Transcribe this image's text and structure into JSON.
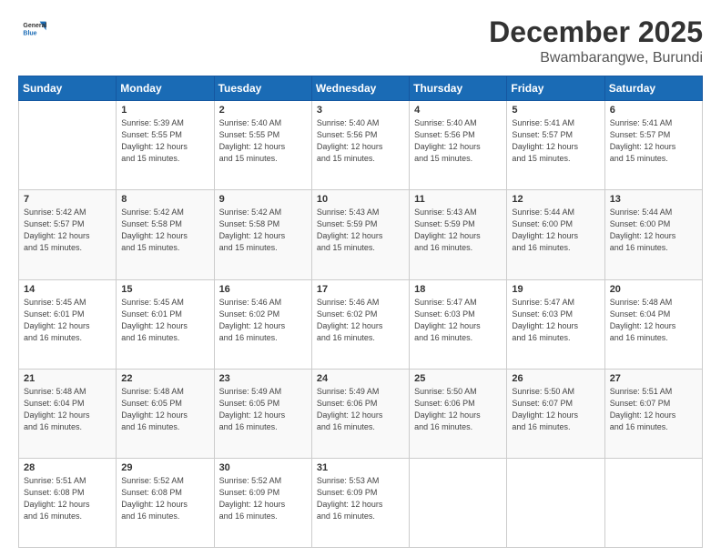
{
  "header": {
    "logo_general": "General",
    "logo_blue": "Blue",
    "month": "December 2025",
    "location": "Bwambarangwe, Burundi"
  },
  "days_of_week": [
    "Sunday",
    "Monday",
    "Tuesday",
    "Wednesday",
    "Thursday",
    "Friday",
    "Saturday"
  ],
  "weeks": [
    [
      {
        "day": "",
        "info": ""
      },
      {
        "day": "1",
        "info": "Sunrise: 5:39 AM\nSunset: 5:55 PM\nDaylight: 12 hours\nand 15 minutes."
      },
      {
        "day": "2",
        "info": "Sunrise: 5:40 AM\nSunset: 5:55 PM\nDaylight: 12 hours\nand 15 minutes."
      },
      {
        "day": "3",
        "info": "Sunrise: 5:40 AM\nSunset: 5:56 PM\nDaylight: 12 hours\nand 15 minutes."
      },
      {
        "day": "4",
        "info": "Sunrise: 5:40 AM\nSunset: 5:56 PM\nDaylight: 12 hours\nand 15 minutes."
      },
      {
        "day": "5",
        "info": "Sunrise: 5:41 AM\nSunset: 5:57 PM\nDaylight: 12 hours\nand 15 minutes."
      },
      {
        "day": "6",
        "info": "Sunrise: 5:41 AM\nSunset: 5:57 PM\nDaylight: 12 hours\nand 15 minutes."
      }
    ],
    [
      {
        "day": "7",
        "info": "Sunrise: 5:42 AM\nSunset: 5:57 PM\nDaylight: 12 hours\nand 15 minutes."
      },
      {
        "day": "8",
        "info": "Sunrise: 5:42 AM\nSunset: 5:58 PM\nDaylight: 12 hours\nand 15 minutes."
      },
      {
        "day": "9",
        "info": "Sunrise: 5:42 AM\nSunset: 5:58 PM\nDaylight: 12 hours\nand 15 minutes."
      },
      {
        "day": "10",
        "info": "Sunrise: 5:43 AM\nSunset: 5:59 PM\nDaylight: 12 hours\nand 15 minutes."
      },
      {
        "day": "11",
        "info": "Sunrise: 5:43 AM\nSunset: 5:59 PM\nDaylight: 12 hours\nand 16 minutes."
      },
      {
        "day": "12",
        "info": "Sunrise: 5:44 AM\nSunset: 6:00 PM\nDaylight: 12 hours\nand 16 minutes."
      },
      {
        "day": "13",
        "info": "Sunrise: 5:44 AM\nSunset: 6:00 PM\nDaylight: 12 hours\nand 16 minutes."
      }
    ],
    [
      {
        "day": "14",
        "info": "Sunrise: 5:45 AM\nSunset: 6:01 PM\nDaylight: 12 hours\nand 16 minutes."
      },
      {
        "day": "15",
        "info": "Sunrise: 5:45 AM\nSunset: 6:01 PM\nDaylight: 12 hours\nand 16 minutes."
      },
      {
        "day": "16",
        "info": "Sunrise: 5:46 AM\nSunset: 6:02 PM\nDaylight: 12 hours\nand 16 minutes."
      },
      {
        "day": "17",
        "info": "Sunrise: 5:46 AM\nSunset: 6:02 PM\nDaylight: 12 hours\nand 16 minutes."
      },
      {
        "day": "18",
        "info": "Sunrise: 5:47 AM\nSunset: 6:03 PM\nDaylight: 12 hours\nand 16 minutes."
      },
      {
        "day": "19",
        "info": "Sunrise: 5:47 AM\nSunset: 6:03 PM\nDaylight: 12 hours\nand 16 minutes."
      },
      {
        "day": "20",
        "info": "Sunrise: 5:48 AM\nSunset: 6:04 PM\nDaylight: 12 hours\nand 16 minutes."
      }
    ],
    [
      {
        "day": "21",
        "info": "Sunrise: 5:48 AM\nSunset: 6:04 PM\nDaylight: 12 hours\nand 16 minutes."
      },
      {
        "day": "22",
        "info": "Sunrise: 5:48 AM\nSunset: 6:05 PM\nDaylight: 12 hours\nand 16 minutes."
      },
      {
        "day": "23",
        "info": "Sunrise: 5:49 AM\nSunset: 6:05 PM\nDaylight: 12 hours\nand 16 minutes."
      },
      {
        "day": "24",
        "info": "Sunrise: 5:49 AM\nSunset: 6:06 PM\nDaylight: 12 hours\nand 16 minutes."
      },
      {
        "day": "25",
        "info": "Sunrise: 5:50 AM\nSunset: 6:06 PM\nDaylight: 12 hours\nand 16 minutes."
      },
      {
        "day": "26",
        "info": "Sunrise: 5:50 AM\nSunset: 6:07 PM\nDaylight: 12 hours\nand 16 minutes."
      },
      {
        "day": "27",
        "info": "Sunrise: 5:51 AM\nSunset: 6:07 PM\nDaylight: 12 hours\nand 16 minutes."
      }
    ],
    [
      {
        "day": "28",
        "info": "Sunrise: 5:51 AM\nSunset: 6:08 PM\nDaylight: 12 hours\nand 16 minutes."
      },
      {
        "day": "29",
        "info": "Sunrise: 5:52 AM\nSunset: 6:08 PM\nDaylight: 12 hours\nand 16 minutes."
      },
      {
        "day": "30",
        "info": "Sunrise: 5:52 AM\nSunset: 6:09 PM\nDaylight: 12 hours\nand 16 minutes."
      },
      {
        "day": "31",
        "info": "Sunrise: 5:53 AM\nSunset: 6:09 PM\nDaylight: 12 hours\nand 16 minutes."
      },
      {
        "day": "",
        "info": ""
      },
      {
        "day": "",
        "info": ""
      },
      {
        "day": "",
        "info": ""
      }
    ]
  ]
}
